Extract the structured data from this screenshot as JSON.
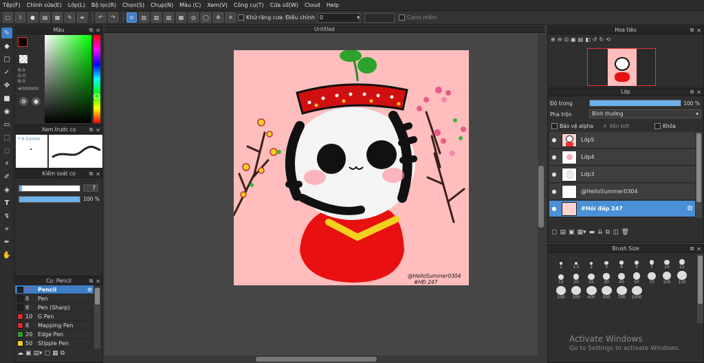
{
  "menu": [
    "Tệp(F)",
    "Chỉnh sửa(E)",
    "Lớp(L)",
    "Bộ lọc(R)",
    "Chọn(S)",
    "Chụp(N)",
    "Màu (C)",
    "Xem(V)",
    "Công cụ(T)",
    "Cửa số(W)",
    "Cloud",
    "Help"
  ],
  "toolbar": {
    "antialias_label": "Khử răng cưa",
    "adjust_label": "Điều chỉnh",
    "adjust_value": "0",
    "edge_label": "Cạnh mềm"
  },
  "color_panel": {
    "title": "Màu",
    "r": "R:0",
    "g": "G:0",
    "b": "B:0",
    "hex": "#000000"
  },
  "brush_preview": {
    "title": "Xem trước cọ",
    "size": "* 0.51mm"
  },
  "brush_control": {
    "title": "Kiểm soát cọ",
    "size_value": "7",
    "opacity_value": "100 %",
    "size_fraction": 0.05,
    "opacity_fraction": 1.0
  },
  "brush_list": {
    "title": "Cọ: Pencil",
    "items": [
      {
        "size": "7",
        "name": "Pencil",
        "color": "#222222",
        "selected": true
      },
      {
        "size": "8",
        "name": "Pen",
        "color": "#222222"
      },
      {
        "size": "8",
        "name": "Pen (Sharp)",
        "color": "#222222"
      },
      {
        "size": "10",
        "name": "G Pen",
        "color": "#d03030"
      },
      {
        "size": "8",
        "name": "Mapping Pen",
        "color": "#d03030"
      },
      {
        "size": "20",
        "name": "Edge Pen",
        "color": "#30a030"
      },
      {
        "size": "50",
        "name": "Stipple Pen",
        "color": "#e8d020"
      }
    ]
  },
  "document": {
    "tab_title": "Untitled",
    "signature_line1": "@HelloSummer0304",
    "signature_line2": "#HĐ 247"
  },
  "navigator": {
    "title": "Hoa tiêu"
  },
  "layers": {
    "title": "Lớp",
    "opacity_label": "Độ trong",
    "opacity_value": "100 %",
    "opacity_fraction": 1.0,
    "blend_label": "Pha trộn",
    "blend_value": "Bình thường",
    "protect_alpha": "Bảo vệ alpha",
    "clipping": "Xén bớt",
    "lock": "Khóa",
    "items": [
      {
        "name": "Lớp5"
      },
      {
        "name": "Lớp4"
      },
      {
        "name": "Lớp3"
      },
      {
        "name": "@HelloSummer0304"
      },
      {
        "name": "#Hỏi đáp 247",
        "selected": true
      }
    ]
  },
  "brush_size": {
    "title": "Brush Size",
    "sizes": [
      "1",
      "1.5",
      "2",
      "3",
      "4",
      "5",
      "7",
      "10",
      "12",
      "15",
      "20",
      "25",
      "30",
      "40",
      "50",
      "70",
      "100",
      "150",
      "200",
      "300",
      "400",
      "500",
      "700",
      "1000"
    ]
  },
  "watermark": {
    "line1": "Activate Windows",
    "line2": "Go to Settings to activate Windows."
  }
}
